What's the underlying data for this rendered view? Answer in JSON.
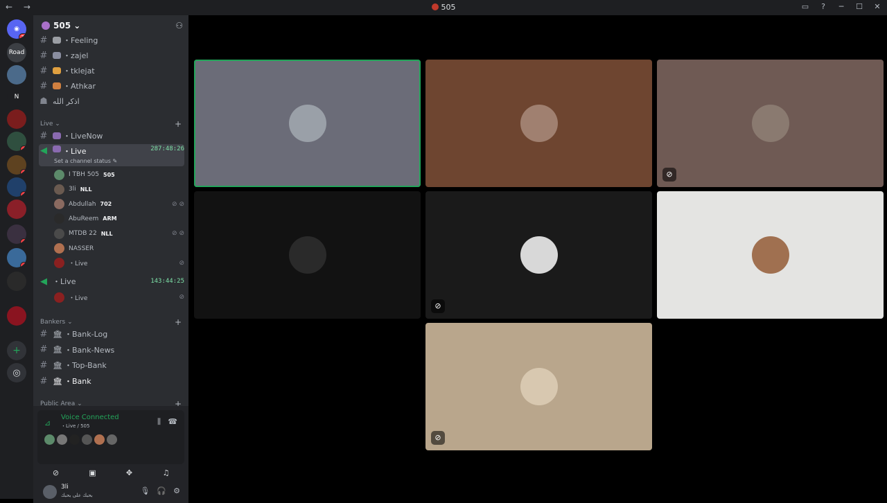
{
  "window": {
    "title": "505",
    "nav_icons": "← →",
    "controls": [
      "▭",
      "?",
      "─",
      "☐",
      "✕"
    ]
  },
  "rail": {
    "home_badge": "71",
    "servers": [
      {
        "label": "Road",
        "color": "#3c3f44",
        "badge": ""
      },
      {
        "label": "",
        "color": "#4b6a8a",
        "badge": ""
      },
      {
        "label": "N",
        "color": "#1e1f22",
        "badge": ""
      },
      {
        "label": "",
        "color": "#7a1d1d",
        "badge": ""
      },
      {
        "label": "",
        "color": "#2f4f3f",
        "badge": "2"
      },
      {
        "label": "",
        "color": "#5e4220",
        "badge": "3"
      },
      {
        "label": "",
        "color": "#20406a",
        "badge": "2"
      },
      {
        "label": "",
        "color": "#8a1f28",
        "badge": ""
      },
      {
        "label": "",
        "color": "#3a3040",
        "badge": "1"
      },
      {
        "label": "",
        "color": "#3a6a9a",
        "badge": "6"
      },
      {
        "label": "",
        "color": "#2a2a2a",
        "badge": ""
      },
      {
        "label": "",
        "color": "#8a1420",
        "badge": ""
      }
    ],
    "add_server": "+",
    "discover": "◎"
  },
  "guild": {
    "name": "505 ⌄"
  },
  "channels": {
    "top_text": [
      {
        "name": "・Feeling",
        "color": "#9b9ea4"
      },
      {
        "name": "・zajel",
        "color": "#8a8ea0"
      },
      {
        "name": "・tklejat",
        "color": "#e0a040"
      },
      {
        "name": "・Athkar",
        "color": "#d08040"
      }
    ],
    "forum": "اذكر الله",
    "live_category": "Live ⌄",
    "live_now": "・LiveNow",
    "live_active": "・Live",
    "live_active_timer": "287:48:26",
    "channel_status": "Set a channel status ✎",
    "members": [
      {
        "name": "I TBH 505",
        "tag": "505",
        "color": "#5c8a6a",
        "icons": ""
      },
      {
        "name": "3li",
        "tag": "NLL",
        "color": "#6a5a50",
        "icons": ""
      },
      {
        "name": "Abdullah",
        "tag": "702",
        "color": "#8a6a60",
        "icons": "⊘ ⊘"
      },
      {
        "name": "AbuReem",
        "tag": "ARM",
        "color": "#2a2a2a",
        "icons": ""
      },
      {
        "name": "MTDB 22",
        "tag": "NLL",
        "color": "#4a4a4a",
        "icons": "⊘ ⊘"
      },
      {
        "name": "NASSER",
        "tag": "",
        "color": "#b07050",
        "icons": ""
      },
      {
        "name": "・Live",
        "tag": "",
        "color": "#8a2020",
        "icons": "⊘"
      }
    ],
    "live_second": "・Live",
    "live_second_timer": "143:44:25",
    "live_second_member": "・Live",
    "bankers_category": "Bankers ⌄",
    "bank_channels": [
      "・Bank-Log",
      "・Bank-News",
      "・Top-Bank",
      "・Bank"
    ],
    "public_category": "Public Area ⌄"
  },
  "voice": {
    "status": "Voice Connected",
    "location": "・Live / 505"
  },
  "user": {
    "name": "3li",
    "status": "بحبك على بحبك"
  },
  "tiles": [
    {
      "bg": "#6b6c78",
      "avatar": "#9aa0a8",
      "speaking": true,
      "muted": false
    },
    {
      "bg": "#6e4530",
      "avatar": "#a08070",
      "speaking": false,
      "muted": false
    },
    {
      "bg": "#6f5a54",
      "avatar": "#8a7a70",
      "speaking": false,
      "muted": true
    },
    {
      "bg": "#121212",
      "avatar": "#2a2a2a",
      "speaking": false,
      "muted": false
    },
    {
      "bg": "#1a1a1a",
      "avatar": "#d8d8d8",
      "speaking": false,
      "muted": true
    },
    {
      "bg": "#e4e4e2",
      "avatar": "#a07050",
      "speaking": false,
      "muted": false
    },
    {
      "bg": "#b9a68c",
      "avatar": "#d8c8b0",
      "speaking": false,
      "muted": true
    }
  ]
}
